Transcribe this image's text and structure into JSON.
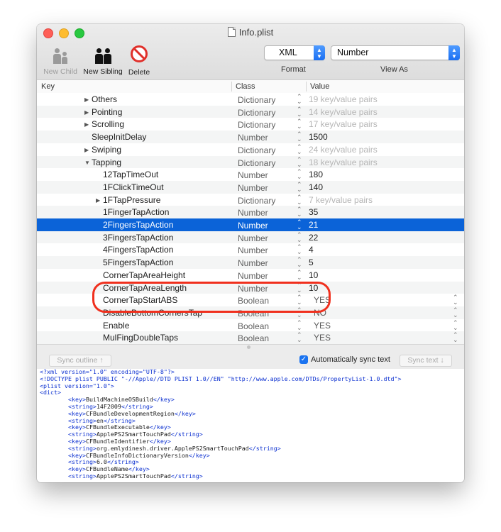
{
  "window": {
    "title": "Info.plist"
  },
  "toolbar": {
    "new_child": "New Child",
    "new_sibling": "New Sibling",
    "delete": "Delete",
    "format_value": "XML",
    "format_label": "Format",
    "viewas_value": "Number",
    "viewas_label": "View As"
  },
  "columns": {
    "key": "Key",
    "class": "Class",
    "value": "Value"
  },
  "rows": [
    {
      "key": "Others",
      "indent": 1,
      "expander": "collapsed",
      "class": "Dictionary",
      "value": "19 key/value pairs",
      "dim": true
    },
    {
      "key": "Pointing",
      "indent": 1,
      "expander": "collapsed",
      "class": "Dictionary",
      "value": "14 key/value pairs",
      "dim": true
    },
    {
      "key": "Scrolling",
      "indent": 1,
      "expander": "collapsed",
      "class": "Dictionary",
      "value": "17 key/value pairs",
      "dim": true
    },
    {
      "key": "SleepInitDelay",
      "indent": 1,
      "expander": "none",
      "class": "Number",
      "value": "1500"
    },
    {
      "key": "Swiping",
      "indent": 1,
      "expander": "collapsed",
      "class": "Dictionary",
      "value": "24 key/value pairs",
      "dim": true
    },
    {
      "key": "Tapping",
      "indent": 1,
      "expander": "expanded",
      "class": "Dictionary",
      "value": "18 key/value pairs",
      "dim": true
    },
    {
      "key": "12TapTimeOut",
      "indent": 2,
      "expander": "none",
      "class": "Number",
      "value": "180"
    },
    {
      "key": "1FClickTimeOut",
      "indent": 2,
      "expander": "none",
      "class": "Number",
      "value": "140"
    },
    {
      "key": "1FTapPressure",
      "indent": 2,
      "expander": "collapsed",
      "class": "Dictionary",
      "value": "7 key/value pairs",
      "dim": true
    },
    {
      "key": "1FingerTapAction",
      "indent": 2,
      "expander": "none",
      "class": "Number",
      "value": "35"
    },
    {
      "key": "2FingersTapAction",
      "indent": 2,
      "expander": "none",
      "class": "Number",
      "value": "21",
      "selected": true
    },
    {
      "key": "3FingersTapAction",
      "indent": 2,
      "expander": "none",
      "class": "Number",
      "value": "22"
    },
    {
      "key": "4FingersTapAction",
      "indent": 2,
      "expander": "none",
      "class": "Number",
      "value": "4"
    },
    {
      "key": "5FingersTapAction",
      "indent": 2,
      "expander": "none",
      "class": "Number",
      "value": "5"
    },
    {
      "key": "CornerTapAreaHeight",
      "indent": 2,
      "expander": "none",
      "class": "Number",
      "value": "10"
    },
    {
      "key": "CornerTapAreaLength",
      "indent": 2,
      "expander": "none",
      "class": "Number",
      "value": "10"
    },
    {
      "key": "CornerTapStartABS",
      "indent": 2,
      "expander": "none",
      "class": "Boolean",
      "value": "YES",
      "bool": true
    },
    {
      "key": "DisableBottomCornersTap",
      "indent": 2,
      "expander": "none",
      "class": "Boolean",
      "value": "NO",
      "bool": true
    },
    {
      "key": "Enable",
      "indent": 2,
      "expander": "none",
      "class": "Boolean",
      "value": "YES",
      "bool": true
    },
    {
      "key": "MulFingDoubleTaps",
      "indent": 2,
      "expander": "none",
      "class": "Boolean",
      "value": "YES",
      "bool": true
    }
  ],
  "sync": {
    "outline_btn": "Sync outline ↑",
    "auto_label": "Automatically sync text",
    "auto_checked": true,
    "text_btn": "Sync text ↓"
  },
  "xml_lines": [
    "<?xml version=\"1.0\" encoding=\"UTF-8\"?>",
    "<!DOCTYPE plist PUBLIC \"-//Apple//DTD PLIST 1.0//EN\" \"http://www.apple.com/DTDs/PropertyList-1.0.dtd\">",
    "<plist version=\"1.0\">",
    "<dict>",
    "        <key>BuildMachineOSBuild</key>",
    "        <string>14F2009</string>",
    "        <key>CFBundleDevelopmentRegion</key>",
    "        <string>en</string>",
    "        <key>CFBundleExecutable</key>",
    "        <string>ApplePS2SmartTouchPad</string>",
    "        <key>CFBundleIdentifier</key>",
    "        <string>org.emlydinesh.driver.ApplePS2SmartTouchPad</string>",
    "        <key>CFBundleInfoDictionaryVersion</key>",
    "        <string>6.0</string>",
    "        <key>CFBundleName</key>",
    "        <string>ApplePS2SmartTouchPad</string>"
  ]
}
